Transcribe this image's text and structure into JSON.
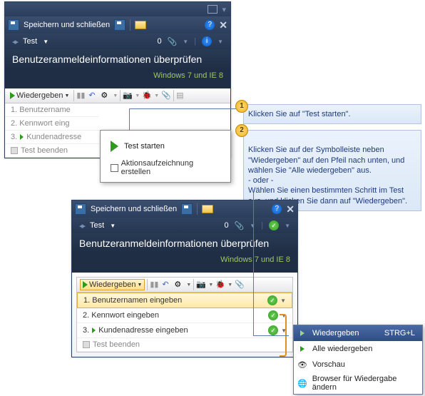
{
  "titlebar": {
    "save_close": "Speichern und schließen"
  },
  "subbar": {
    "test_label": "Test",
    "count": "0"
  },
  "heading": "Benutzeranmeldeinformationen überprüfen",
  "config": "Windows 7 und IE 8",
  "toolbar": {
    "replay": "Wiedergeben"
  },
  "win1_steps": {
    "s1": "1. Benutzername",
    "s2": "2. Kennwort eing",
    "s3": "3.",
    "s3b": "Kundenadresse",
    "s4": "Test beenden"
  },
  "popup": {
    "title": "Test starten",
    "checkbox": "Aktionsaufzeichnung erstellen"
  },
  "win2_steps": {
    "s1": "1. Benutzernamen eingeben",
    "s2": "2. Kennwort eingeben",
    "s3": "3.",
    "s3b": "Kundenadresse eingeben",
    "s4": "Test beenden"
  },
  "callouts": {
    "c1": "Klicken Sie auf \"Test starten\".",
    "c2": "Klicken Sie auf der Symbolleiste neben \"Wiedergeben\" auf den Pfeil nach unten, und wählen Sie \"Alle wiedergeben\" aus.\n- oder -\nWählen Sie einen bestimmten Schritt im Test aus, und klicken Sie dann auf \"Wiedergeben\"."
  },
  "menu": {
    "m1": "Wiedergeben",
    "m1_sc": "STRG+L",
    "m2": "Alle wiedergeben",
    "m3": "Vorschau",
    "m4": "Browser für Wiedergabe ändern"
  }
}
